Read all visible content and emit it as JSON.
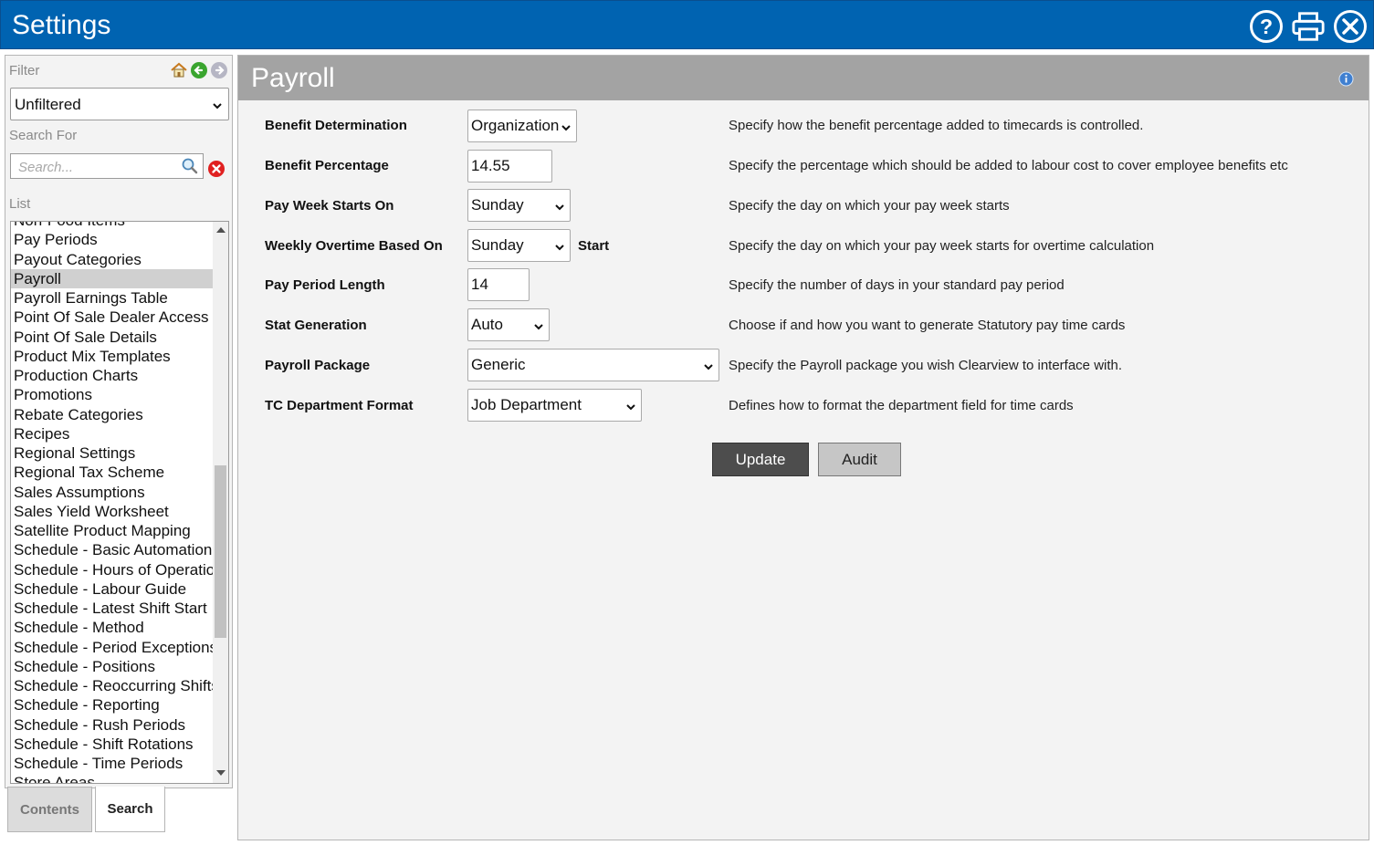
{
  "app": {
    "title": "Settings"
  },
  "sidebar": {
    "filter_label": "Filter",
    "filter_value": "Unfiltered",
    "search_for_label": "Search For",
    "search_placeholder": "Search...",
    "list_label": "List",
    "items": [
      "Non-Food Items",
      "Pay Periods",
      "Payout Categories",
      "Payroll",
      "Payroll Earnings Table",
      "Point Of Sale Dealer Access",
      "Point Of Sale Details",
      "Product Mix Templates",
      "Production Charts",
      "Promotions",
      "Rebate Categories",
      "Recipes",
      "Regional Settings",
      "Regional Tax Scheme",
      "Sales Assumptions",
      "Sales Yield Worksheet",
      "Satellite Product Mapping",
      "Schedule - Basic Automation",
      "Schedule - Hours of Operation",
      "Schedule - Labour Guide",
      "Schedule - Latest Shift Start",
      "Schedule - Method",
      "Schedule - Period Exceptions",
      "Schedule - Positions",
      "Schedule - Reoccurring Shifts",
      "Schedule - Reporting",
      "Schedule - Rush Periods",
      "Schedule - Shift Rotations",
      "Schedule - Time Periods",
      "Store Areas"
    ],
    "selected_item": "Payroll",
    "tabs": {
      "contents": "Contents",
      "search": "Search"
    }
  },
  "main": {
    "title": "Payroll",
    "fields": {
      "benefit_determination": {
        "label": "Benefit Determination",
        "value": "Organization",
        "desc": "Specify how the benefit percentage added to timecards is controlled."
      },
      "benefit_percentage": {
        "label": "Benefit Percentage",
        "value": "14.55",
        "desc": "Specify the percentage which should be added to labour cost to cover employee benefits etc"
      },
      "pay_week_starts_on": {
        "label": "Pay Week Starts On",
        "value": "Sunday",
        "desc": "Specify the day on which your pay week starts"
      },
      "weekly_overtime": {
        "label": "Weekly Overtime Based On",
        "value": "Sunday",
        "suffix": "Start",
        "desc": "Specify the day on which your pay week starts for overtime calculation"
      },
      "pay_period_length": {
        "label": "Pay Period Length",
        "value": "14",
        "desc": "Specify the number of days in your standard pay period"
      },
      "stat_generation": {
        "label": "Stat Generation",
        "value": "Auto",
        "desc": "Choose if and how you want to generate Statutory pay time cards"
      },
      "payroll_package": {
        "label": "Payroll Package",
        "value": "Generic",
        "desc": "Specify the Payroll package you wish Clearview to interface with."
      },
      "tc_department_format": {
        "label": "TC Department Format",
        "value": "Job Department",
        "desc": "Defines how to format the department field for time cards"
      }
    },
    "buttons": {
      "update": "Update",
      "audit": "Audit"
    }
  },
  "colors": {
    "titlebar": "#0063b1",
    "header": "#a3a3a3",
    "update_button": "#4d4d4d"
  }
}
